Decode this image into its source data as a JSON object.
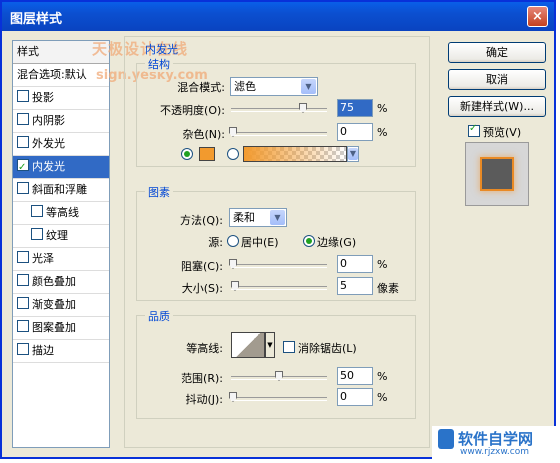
{
  "window": {
    "title": "图层样式",
    "close_glyph": "×"
  },
  "sidebar": {
    "header": "样式",
    "default_item": "混合选项:默认",
    "items": [
      {
        "label": "投影",
        "checked": false
      },
      {
        "label": "内阴影",
        "checked": false
      },
      {
        "label": "外发光",
        "checked": false
      },
      {
        "label": "内发光",
        "checked": true
      },
      {
        "label": "斜面和浮雕",
        "checked": false
      },
      {
        "label": "等高线",
        "checked": false
      },
      {
        "label": "纹理",
        "checked": false
      },
      {
        "label": "光泽",
        "checked": false
      },
      {
        "label": "颜色叠加",
        "checked": false
      },
      {
        "label": "渐变叠加",
        "checked": false
      },
      {
        "label": "图案叠加",
        "checked": false
      },
      {
        "label": "描边",
        "checked": false
      }
    ]
  },
  "panel": {
    "title": "内发光",
    "structure": {
      "legend": "结构",
      "blend_mode_label": "混合模式:",
      "blend_mode_value": "滤色",
      "opacity_label": "不透明度(O):",
      "opacity_value": "75",
      "opacity_fraction": 0.75,
      "noise_label": "杂色(N):",
      "noise_value": "0",
      "percent": "%"
    },
    "elements": {
      "legend": "图素",
      "method_label": "方法(Q):",
      "method_value": "柔和",
      "source_label": "源:",
      "source_center": "居中(E)",
      "source_edge": "边缘(G)",
      "choke_label": "阻塞(C):",
      "choke_value": "0",
      "size_label": "大小(S):",
      "size_value": "5",
      "size_unit": "像素"
    },
    "quality": {
      "legend": "品质",
      "contour_label": "等高线:",
      "anti_alias_label": "消除锯齿(L)",
      "range_label": "范围(R):",
      "range_value": "50",
      "range_fraction": 0.5,
      "jitter_label": "抖动(J):",
      "jitter_value": "0"
    },
    "glow_color": "#f29a2e"
  },
  "buttons": {
    "ok": "确定",
    "cancel": "取消",
    "new_style": "新建样式(W)...",
    "preview_label": "预览(V)"
  },
  "watermark": {
    "line1": "天极设计在线",
    "line2": "sign.yesky.com"
  },
  "brand": {
    "name": "软件自学网",
    "url": "www.rjzxw.com"
  }
}
